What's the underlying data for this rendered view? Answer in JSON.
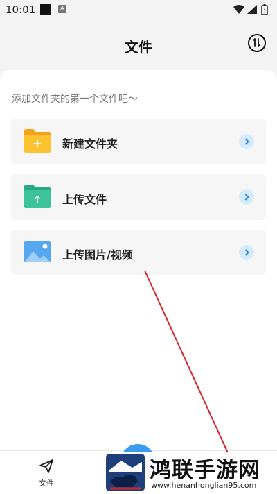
{
  "status_bar": {
    "time": "10:01",
    "a_icon": "A"
  },
  "header": {
    "title": "文件",
    "sort_icon": "sort-arrows-icon"
  },
  "hint": "添加文件夹的第一个文件吧～",
  "actions": [
    {
      "label": "新建文件夹",
      "icon": "new-folder-icon",
      "icon_color": "#f6b825"
    },
    {
      "label": "上传文件",
      "icon": "upload-folder-icon",
      "icon_color": "#3cc39a"
    },
    {
      "label": "上传图片/视频",
      "icon": "image-icon",
      "icon_color": "#56a6f0"
    }
  ],
  "bottom_nav": {
    "label": "文件",
    "icon": "paper-plane-icon"
  },
  "watermark": {
    "name": "鸿联手游网",
    "url": "www.henanhonglian95.com"
  },
  "colors": {
    "accent": "#3a9bf0",
    "chevron_bg": "#d5ebfb",
    "annotation": "#d8232a"
  }
}
